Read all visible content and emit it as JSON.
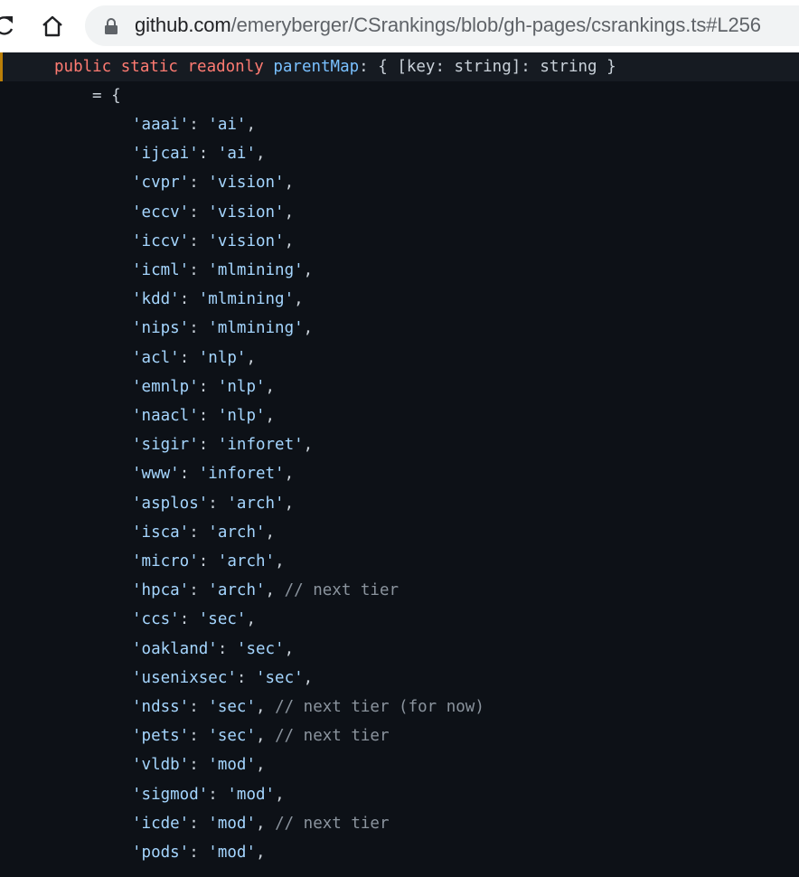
{
  "browser": {
    "url_host": "github.com",
    "url_path": "/emeryberger/CSrankings/blob/gh-pages/csrankings.ts#L256"
  },
  "code": {
    "declaration": {
      "modifiers": "public static readonly",
      "name": "parentMap",
      "type": ": { [key: string]: string }"
    },
    "assign": "= {",
    "entries": [
      {
        "key": "'aaai'",
        "value": "'ai'",
        "comment": ""
      },
      {
        "key": "'ijcai'",
        "value": "'ai'",
        "comment": ""
      },
      {
        "key": "'cvpr'",
        "value": "'vision'",
        "comment": ""
      },
      {
        "key": "'eccv'",
        "value": "'vision'",
        "comment": ""
      },
      {
        "key": "'iccv'",
        "value": "'vision'",
        "comment": ""
      },
      {
        "key": "'icml'",
        "value": "'mlmining'",
        "comment": ""
      },
      {
        "key": "'kdd'",
        "value": "'mlmining'",
        "comment": ""
      },
      {
        "key": "'nips'",
        "value": "'mlmining'",
        "comment": ""
      },
      {
        "key": "'acl'",
        "value": "'nlp'",
        "comment": ""
      },
      {
        "key": "'emnlp'",
        "value": "'nlp'",
        "comment": ""
      },
      {
        "key": "'naacl'",
        "value": "'nlp'",
        "comment": ""
      },
      {
        "key": "'sigir'",
        "value": "'inforet'",
        "comment": ""
      },
      {
        "key": "'www'",
        "value": "'inforet'",
        "comment": ""
      },
      {
        "key": "'asplos'",
        "value": "'arch'",
        "comment": ""
      },
      {
        "key": "'isca'",
        "value": "'arch'",
        "comment": ""
      },
      {
        "key": "'micro'",
        "value": "'arch'",
        "comment": ""
      },
      {
        "key": "'hpca'",
        "value": "'arch'",
        "comment": "// next tier"
      },
      {
        "key": "'ccs'",
        "value": "'sec'",
        "comment": ""
      },
      {
        "key": "'oakland'",
        "value": "'sec'",
        "comment": ""
      },
      {
        "key": "'usenixsec'",
        "value": "'sec'",
        "comment": ""
      },
      {
        "key": "'ndss'",
        "value": "'sec'",
        "comment": "// next tier (for now)"
      },
      {
        "key": "'pets'",
        "value": "'sec'",
        "comment": "// next tier"
      },
      {
        "key": "'vldb'",
        "value": "'mod'",
        "comment": ""
      },
      {
        "key": "'sigmod'",
        "value": "'mod'",
        "comment": ""
      },
      {
        "key": "'icde'",
        "value": "'mod'",
        "comment": "// next tier"
      },
      {
        "key": "'pods'",
        "value": "'mod'",
        "comment": ""
      }
    ]
  },
  "colors": {
    "background": "#0d1117",
    "keyword": "#ff7b72",
    "identifier": "#79c0ff",
    "string": "#a5d6ff",
    "comment": "#8b949e",
    "highlight_bar": "#bb8009"
  }
}
